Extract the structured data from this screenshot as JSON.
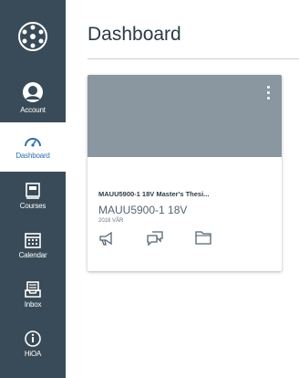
{
  "sidebar": {
    "items": [
      {
        "label": "Account",
        "icon": "account-icon"
      },
      {
        "label": "Dashboard",
        "icon": "dashboard-icon",
        "active": true
      },
      {
        "label": "Courses",
        "icon": "courses-icon"
      },
      {
        "label": "Calendar",
        "icon": "calendar-icon"
      },
      {
        "label": "Inbox",
        "icon": "inbox-icon"
      },
      {
        "label": "HiOA",
        "icon": "info-icon"
      }
    ]
  },
  "header": {
    "title": "Dashboard"
  },
  "course_card": {
    "name": "MAUU5900-1 18V Master's Thesi...",
    "code": "MAUU5900-1 18V",
    "term": "2018 VÅR",
    "hero_color": "#8a96a0",
    "actions": [
      "announcements-icon",
      "discussions-icon",
      "files-icon"
    ]
  },
  "colors": {
    "sidebar_bg": "#394b58",
    "active_accent": "#2d6fb0"
  }
}
